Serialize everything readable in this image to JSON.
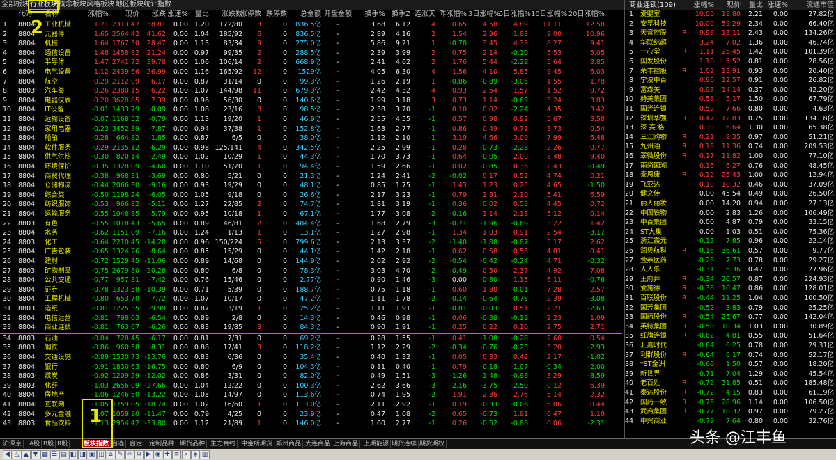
{
  "top_tabs": [
    "全部板块",
    "行业板块",
    "概念板块",
    "风格板块",
    "地区板块",
    "统计指数"
  ],
  "active_tab_index": 1,
  "columns": [
    "代码",
    "名称",
    "涨幅%",
    "现价",
    "涨跌",
    "涨速%",
    "量比",
    "涨跌数",
    "涨停数",
    "跌停数",
    "总金额",
    "开盘金额",
    "换手%",
    "换手Z",
    "连涨天",
    "昨涨幅%",
    "3日涨幅%",
    "5日涨幅%",
    "10日涨幅%",
    "20日涨幅%"
  ],
  "rows": [
    [
      "880446",
      "工业机械",
      "1.71",
      "2313.47",
      "38.81",
      "0.00",
      "1.20",
      "172/80",
      "3",
      "0",
      "836.5亿",
      "-",
      "3.68",
      "6.12",
      "4",
      "0.65",
      "4.58",
      "4.89",
      "11.11",
      "12.58"
    ],
    [
      "880456",
      "元器件",
      "1.65",
      "2564.42",
      "41.62",
      "0.00",
      "1.04",
      "185/92",
      "6",
      "0",
      "836.5亿",
      "-",
      "2.89",
      "4.16",
      "2",
      "1.54",
      "2.96",
      "1.83",
      "9.00",
      "10.96"
    ],
    [
      "880447",
      "机械",
      "1.64",
      "1767.30",
      "28.47",
      "0.00",
      "1.13",
      "83/34",
      "9",
      "0",
      "275.0亿",
      "-",
      "5.86",
      "9.21",
      "1",
      "-0.78",
      "3.45",
      "4.39",
      "8.27",
      "9.41"
    ],
    [
      "880490",
      "通信设备",
      "1.48",
      "1458.82",
      "21.24",
      "0.00",
      "0.97",
      "99/35",
      "2",
      "0",
      "288.5亿",
      "-",
      "2.39",
      "3.99",
      "2",
      "0.75",
      "2.14",
      "-0.10",
      "5.53",
      "5.05"
    ],
    [
      "880491",
      "半导体",
      "1.47",
      "2741.72",
      "39.78",
      "0.00",
      "1.06",
      "106/14",
      "2",
      "0",
      "668.9亿",
      "-",
      "2.41",
      "4.62",
      "2",
      "1.76",
      "5.44",
      "-2.29",
      "5.64",
      "8.85"
    ],
    [
      "880446",
      "电气设备",
      "1.12",
      "2439.66",
      "26.99",
      "0.00",
      "1.16",
      "165/92",
      "12",
      "0",
      "1529亿",
      "-",
      "4.05",
      "6.30",
      "4",
      "1.56",
      "4.10",
      "5.85",
      "9.45",
      "6.03"
    ],
    [
      "880430",
      "航空",
      "0.29",
      "2112.09",
      "6.17",
      "0.00",
      "0.87",
      "31/14",
      "0",
      "0",
      "99.3亿",
      "-",
      "1.26",
      "2.19",
      "1",
      "-0.86",
      "-0.89",
      "-3.06",
      "1.55",
      "1.78"
    ],
    [
      "880390",
      "汽车类",
      "0.26",
      "2380.15",
      "6.22",
      "0.00",
      "1.07",
      "144/98",
      "11",
      "0",
      "679.3亿",
      "-",
      "2.42",
      "4.32",
      "4",
      "0.93",
      "2.54",
      "1.57",
      "1.52",
      "0.72"
    ],
    [
      "880448",
      "电器仪表",
      "0.20",
      "3628.85",
      "7.39",
      "0.00",
      "0.96",
      "56/30",
      "0",
      "0",
      "140.6亿",
      "-",
      "1.99",
      "3.18",
      "3",
      "0.73",
      "1.14",
      "-0.69",
      "3.24",
      "3.83"
    ],
    [
      "880489",
      "IT设备",
      "-0.01",
      "1433.79",
      "-0.09",
      "0.00",
      "1.08",
      "23/16",
      "3",
      "0",
      "98.5亿",
      "-",
      "2.38",
      "3.70",
      "-1",
      "0.10",
      "0.02",
      "-2.24",
      "4.35",
      "3.42"
    ],
    [
      "880432",
      "运输设备",
      "-0.07",
      "1168.52",
      "-0.79",
      "0.00",
      "1.13",
      "19/20",
      "1",
      "0",
      "46.9亿",
      "-",
      "2.55",
      "4.55",
      "-1",
      "0.57",
      "0.98",
      "0.92",
      "5.67",
      "3.58"
    ],
    [
      "880423",
      "家用电器",
      "-0.23",
      "3452.39",
      "-7.87",
      "0.00",
      "0.94",
      "37/38",
      "1",
      "0",
      "152.8亿",
      "-",
      "1.63",
      "2.77",
      "-1",
      "0.86",
      "0.49",
      "0.71",
      "3.73",
      "0.54"
    ],
    [
      "880431",
      "船舶",
      "-0.28",
      "664.82",
      "-1.85",
      "0.00",
      "0.87",
      "6/5",
      "0",
      "0",
      "38.0亿",
      "-",
      "1.12",
      "2.10",
      "-1",
      "3.19",
      "4.66",
      "3.09",
      "7.99",
      "6.48"
    ],
    [
      "880493",
      "软件服务",
      "-0.29",
      "2135.12",
      "-6.29",
      "0.00",
      "0.98",
      "125/141",
      "4",
      "0",
      "342.5亿",
      "-",
      "2.25",
      "2.99",
      "-1",
      "0.28",
      "-0.73",
      "-2.28",
      "2.26",
      "0.77"
    ],
    [
      "880455",
      "供气供热",
      "-0.30",
      "820.14",
      "-2.49",
      "0.00",
      "1.02",
      "10/29",
      "1",
      "0",
      "44.3亿",
      "-",
      "1.70",
      "3.73",
      "-1",
      "0.64",
      "-0.05",
      "2.00",
      "8.48",
      "9.40"
    ],
    [
      "880456",
      "环境保护",
      "-0.35",
      "1328.09",
      "-4.60",
      "0.00",
      "1.10",
      "51/70",
      "1",
      "0",
      "94.4亿",
      "-",
      "1.59",
      "2.66",
      "-1",
      "0.02",
      "-0.85",
      "0.36",
      "2.43",
      "-0.49"
    ],
    [
      "880414",
      "商贸代理",
      "-0.38",
      "968.31",
      "-3.69",
      "0.00",
      "0.80",
      "5/21",
      "0",
      "0",
      "21.3亿",
      "-",
      "1.24",
      "2.41",
      "-2",
      "-0.02",
      "0.17",
      "0.52",
      "4.74",
      "0.21"
    ],
    [
      "880494",
      "仓储物流",
      "-0.44",
      "2066.30",
      "-9.16",
      "0.00",
      "0.93",
      "19/29",
      "0",
      "0",
      "48.1亿",
      "-",
      "0.85",
      "1.75",
      "-1",
      "1.43",
      "1.23",
      "0.25",
      "4.65",
      "-1.50"
    ],
    [
      "880497",
      "综合类",
      "-0.50",
      "1198.24",
      "-6.05",
      "0.00",
      "1.05",
      "9/18",
      "0",
      "0",
      "26.6亿",
      "-",
      "2.17",
      "3.23",
      "-1",
      "0.79",
      "1.81",
      "2.10",
      "5.41",
      "6.59"
    ],
    [
      "880497",
      "纺织服饰",
      "-0.53",
      "966.82",
      "-5.11",
      "0.00",
      "1.27",
      "22/85",
      "2",
      "0",
      "74.7亿",
      "-",
      "1.81",
      "3.19",
      "-1",
      "0.36",
      "0.02",
      "0.53",
      "4.45",
      "0.72"
    ],
    [
      "880453",
      "运输服务",
      "-0.55",
      "1048.85",
      "-5.79",
      "0.00",
      "0.95",
      "10/18",
      "1",
      "0",
      "67.1亿",
      "-",
      "1.77",
      "3.08",
      "-2",
      "-0.16",
      "1.14",
      "2.18",
      "5.12",
      "0.14"
    ],
    [
      "880324",
      "有色",
      "-0.55",
      "1018.43",
      "-5.65",
      "0.00",
      "0.89",
      "46/81",
      "2",
      "0",
      "484.4亿",
      "-",
      "1.68",
      "2.79",
      "-3",
      "-0.71",
      "-1.96",
      "-0.69",
      "3.22",
      "1.42"
    ],
    [
      "880475",
      "水务",
      "-0.62",
      "1151.09",
      "-7.16",
      "0.00",
      "1.24",
      "1/13",
      "1",
      "0",
      "13.1亿",
      "-",
      "1.27",
      "2.98",
      "-1",
      "1.34",
      "1.03",
      "0.91",
      "2.54",
      "-3.17"
    ],
    [
      "880335",
      "化工",
      "-0.64",
      "2210.45",
      "-14.28",
      "0.00",
      "0.96",
      "150/224",
      "5",
      "0",
      "799.6亿",
      "-",
      "2.13",
      "3.37",
      "-2",
      "-1.40",
      "-1.88",
      "-0.87",
      "5.17",
      "2.62"
    ],
    [
      "880421",
      "广告包装",
      "-0.65",
      "1324.26",
      "-8.64",
      "0.00",
      "0.85",
      "15/29",
      "0",
      "0",
      "44.1亿",
      "-",
      "1.42",
      "2.18",
      "-1",
      "0.62",
      "0.58",
      "0.53",
      "4.81",
      "0.41"
    ],
    [
      "880424",
      "建材",
      "-0.72",
      "1529.45",
      "-11.06",
      "0.00",
      "0.89",
      "14/68",
      "0",
      "0",
      "144.9亿",
      "-",
      "2.02",
      "2.92",
      "-2",
      "-0.54",
      "-0.42",
      "-0.24",
      "4.71",
      "-0.32"
    ],
    [
      "880351",
      "矿物制品",
      "-0.75",
      "2679.80",
      "-20.28",
      "0.00",
      "0.80",
      "6/8",
      "0",
      "0",
      "78.3亿",
      "-",
      "3.03",
      "4.70",
      "-2",
      "-0.49",
      "0.50",
      "2.37",
      "4.92",
      "7.08"
    ],
    [
      "880455",
      "公共交通",
      "-0.77",
      "957.81",
      "-7.42",
      "0.00",
      "0.76",
      "15/46",
      "0",
      "0",
      "2.77亿",
      "-",
      "0.90",
      "1.46",
      "-3",
      "0.00",
      "-0.80",
      "1.15",
      "6.11",
      "-0.76"
    ],
    [
      "880472",
      "证券",
      "-0.78",
      "1323.58",
      "-10.39",
      "0.00",
      "0.71",
      "5/39",
      "0",
      "0",
      "188.7亿",
      "-",
      "0.75",
      "1.18",
      "-1",
      "0.60",
      "1.80",
      "-0.01",
      "7.28",
      "2.57"
    ],
    [
      "880447",
      "工程机械",
      "-0.80",
      "653.70",
      "-7.72",
      "0.00",
      "1.07",
      "10/17",
      "0",
      "0",
      "47.2亿",
      "-",
      "1.11",
      "1.78",
      "-2",
      "-0.14",
      "-0.64",
      "-0.78",
      "2.39",
      "-3.08"
    ],
    [
      "880350",
      "造纸",
      "-0.81",
      "1225.35",
      "-9.99",
      "0.00",
      "0.87",
      "3/19",
      "1",
      "0",
      "25.2亿",
      "-",
      "1.11",
      "1.91",
      "-1",
      "-0.81",
      "-0.03",
      "0.51",
      "2.21",
      "-2.63"
    ],
    [
      "880452",
      "电信运营",
      "-0.81",
      "798.03",
      "-6.54",
      "0.00",
      "0.89",
      "2/8",
      "0",
      "0",
      "14.3亿",
      "-",
      "0.46",
      "0.98",
      "-1",
      "0.06",
      "-0.38",
      "-0.19",
      "2.23",
      "1.09"
    ],
    [
      "880406",
      "商业连锁",
      "-0.81",
      "763.67",
      "-6.26",
      "0.00",
      "0.83",
      "19/85",
      "3",
      "0",
      "84.3亿",
      "-",
      "0.90",
      "1.91",
      "-1",
      "0.25",
      "0.22",
      "0.10",
      "2.75",
      "2.71"
    ],
    [
      "880310",
      "石油",
      "-0.84",
      "728.45",
      "-6.17",
      "0.00",
      "0.81",
      "7/31",
      "0",
      "0",
      "69.2亿",
      "-",
      "0.28",
      "1.55",
      "-1",
      "0.41",
      "-1.08",
      "-0.28",
      "2.68",
      "0.54"
    ],
    [
      "880318",
      "钢铁",
      "-0.86",
      "960.58",
      "-8.31",
      "0.00",
      "0.88",
      "17/41",
      "3",
      "0",
      "118.2亿",
      "-",
      "1.12",
      "2.29",
      "-2",
      "-0.34",
      "-0.76",
      "-0.23",
      "3.20",
      "-2.93"
    ],
    [
      "880465",
      "交通设施",
      "-0.89",
      "1530.73",
      "-13.76",
      "0.00",
      "0.83",
      "6/36",
      "0",
      "0",
      "35.4亿",
      "-",
      "0.40",
      "1.32",
      "-1",
      "0.05",
      "0.33",
      "0.42",
      "2.17",
      "-1.02"
    ],
    [
      "880471",
      "银行",
      "-0.91",
      "1830.63",
      "-16.75",
      "0.00",
      "0.80",
      "6/9",
      "0",
      "0",
      "104.3亿",
      "-",
      "0.11",
      "0.40",
      "-1",
      "0.79",
      "-0.18",
      "-1.07",
      "-0.34",
      "-2.00"
    ],
    [
      "880301",
      "煤炭",
      "-0.92",
      "1209.29",
      "-12.02",
      "0.00",
      "0.86",
      "3/31",
      "0",
      "0",
      "82.0亿",
      "-",
      "0.49",
      "1.51",
      "-3",
      "-1.26",
      "-1.48",
      "-0.98",
      "3.29",
      "-8.59"
    ],
    [
      "880330",
      "化纤",
      "-1.03",
      "2656.09",
      "-27.66",
      "0.00",
      "1.04",
      "12/22",
      "0",
      "0",
      "100.3亿",
      "-",
      "2.62",
      "3.66",
      "-3",
      "-2.16",
      "-3.75",
      "-2.50",
      "0.12",
      "6.39"
    ],
    [
      "880482",
      "房地产",
      "-1.06",
      "1246.50",
      "-13.22",
      "0.00",
      "1.03",
      "14/97",
      "0",
      "0",
      "113.6亿",
      "-",
      "0.74",
      "1.95",
      "-2",
      "1.91",
      "2.36",
      "2.76",
      "5.14",
      "2.32"
    ],
    [
      "880494",
      "互联网",
      "-1.05",
      "1759.05",
      "-18.74",
      "0.00",
      "1.02",
      "16/60",
      "1",
      "0",
      "113.0亿",
      "-",
      "2.11",
      "2.92",
      "-1",
      "0.19",
      "-0.33",
      "-0.06",
      "5.86",
      "0.44"
    ],
    [
      "880474",
      "多元金融",
      "-1.07",
      "1059.90",
      "-11.47",
      "0.00",
      "0.79",
      "4/25",
      "0",
      "0",
      "23.9亿",
      "-",
      "0.47",
      "1.08",
      "-2",
      "0.65",
      "-0.73",
      "1.91",
      "6.47",
      "1.10"
    ],
    [
      "880372",
      "食品饮料",
      "-1.13",
      "2954.42",
      "-33.80",
      "0.00",
      "1.12",
      "21/89",
      "1",
      "0",
      "146.0亿",
      "-",
      "1.60",
      "2.77",
      "-1",
      "0.26",
      "-0.52",
      "-0.86",
      "0.06",
      "-2.31"
    ]
  ],
  "separator_after_row": 33,
  "right_panel": {
    "title": "商业连锁(109)",
    "columns": [
      "",
      "涨幅%",
      "现价",
      "量比",
      "涨速%",
      "流通市值"
    ],
    "rows": [
      [
        "1",
        "爱婴室",
        "",
        "10.00",
        "19.80",
        "2.21",
        "0.00",
        "27.82亿"
      ],
      [
        "2",
        "安孚科技",
        "",
        "10.00",
        "59.29",
        "2.34",
        "0.00",
        "66.40亿"
      ],
      [
        "3",
        "天音控股",
        "R",
        "9.98",
        "13.11",
        "2.43",
        "0.00",
        "134.26亿"
      ],
      [
        "4",
        "华联综超",
        "",
        "3.24",
        "7.02",
        "1.36",
        "0.00",
        "46.74亿"
      ],
      [
        "5",
        "一心堂",
        "R",
        "1.11",
        "25.45",
        "1.42",
        "0.00",
        "101.39亿"
      ],
      [
        "6",
        "国发股份",
        "",
        "1.10",
        "5.52",
        "0.81",
        "0.00",
        "28.56亿"
      ],
      [
        "7",
        "荣丰控股",
        "R",
        "1.02",
        "13.91",
        "0.93",
        "0.00",
        "20.40亿"
      ],
      [
        "8",
        "宁波中百",
        "",
        "0.96",
        "12.57",
        "0.91",
        "0.00",
        "26.82亿"
      ],
      [
        "9",
        "富森美",
        "",
        "0.93",
        "14.14",
        "0.37",
        "0.00",
        "42.20亿"
      ],
      [
        "10",
        "赫美集团",
        "",
        "0.58",
        "5.17",
        "1.50",
        "0.00",
        "67.79亿"
      ],
      [
        "11",
        "国光连锁",
        "",
        "0.52",
        "7.66",
        "0.80",
        "0.00",
        "4.63亿"
      ],
      [
        "12",
        "深圳华强",
        "R",
        "0.47",
        "12.83",
        "0.75",
        "0.00",
        "134.18亿"
      ],
      [
        "13",
        "深 赛 格",
        "",
        "0.30",
        "6.64",
        "1.30",
        "0.00",
        "65.38亿"
      ],
      [
        "14",
        "三江购物",
        "R",
        "0.21",
        "9.35",
        "0.97",
        "0.00",
        "51.21亿"
      ],
      [
        "15",
        "九州通",
        "R",
        "0.18",
        "11.36",
        "0.74",
        "0.00",
        "209.53亿"
      ],
      [
        "16",
        "翠微股份",
        "R",
        "0.17",
        "11.82",
        "1.00",
        "0.00",
        "77.10亿"
      ],
      [
        "17",
        "雨尚国潮",
        "",
        "0.16",
        "6.27",
        "0.76",
        "0.00",
        "48.45亿"
      ],
      [
        "18",
        "泰恩康",
        "R",
        "0.12",
        "25.43",
        "1.00",
        "0.00",
        "12.94亿"
      ],
      [
        "19",
        "飞亚达",
        "",
        "0.10",
        "10.32",
        "0.46",
        "0.00",
        "37.09亿"
      ],
      [
        "20",
        "健之佳",
        "",
        "0.00",
        "45.54",
        "0.49",
        "0.00",
        "26.50亿"
      ],
      [
        "21",
        "丽人丽妆",
        "",
        "0.00",
        "14.20",
        "0.94",
        "0.00",
        "27.13亿"
      ],
      [
        "22",
        "中国铁物",
        "",
        "0.00",
        "2.83",
        "1.26",
        "0.00",
        "106.49亿"
      ],
      [
        "23",
        "中百集团",
        "",
        "0.00",
        "4.87",
        "0.79",
        "0.00",
        "33.15亿"
      ],
      [
        "24",
        "ST大集",
        "",
        "0.00",
        "1.03",
        "0.51",
        "0.00",
        "75.36亿"
      ],
      [
        "25",
        "浙江震元",
        "",
        "-0.13",
        "7.85",
        "0.96",
        "0.00",
        "22.14亿"
      ],
      [
        "26",
        "润贝航科",
        "R",
        "-0.16",
        "36.61",
        "0.57",
        "0.00",
        "9.77亿"
      ],
      [
        "27",
        "萱燕医药",
        "",
        "-0.26",
        "7.73",
        "0.78",
        "0.00",
        "29.27亿"
      ],
      [
        "28",
        "人人乐",
        "",
        "-0.31",
        "6.36",
        "0.47",
        "0.00",
        "27.96亿"
      ],
      [
        "29",
        "王府井",
        "R",
        "-0.34",
        "20.57",
        "0.87",
        "0.00",
        "224.93亿"
      ],
      [
        "30",
        "爱施德",
        "R",
        "-0.38",
        "10.47",
        "0.86",
        "0.00",
        "128.01亿"
      ],
      [
        "31",
        "百联股份",
        "R",
        "-0.44",
        "11.25",
        "1.04",
        "0.00",
        "100.50亿"
      ],
      [
        "32",
        "国芳集团",
        "",
        "-0.52",
        "3.83",
        "0.79",
        "0.00",
        "25.25亿"
      ],
      [
        "33",
        "国药股份",
        "R",
        "-0.54",
        "25.67",
        "0.77",
        "0.00",
        "142.04亿"
      ],
      [
        "34",
        "英特集团",
        "R",
        "-0.58",
        "10.34",
        "1.03",
        "0.00",
        "30.89亿"
      ],
      [
        "35",
        "红旗连锁",
        "R",
        "-0.62",
        "4.81",
        "0.55",
        "0.00",
        "51.64亿"
      ],
      [
        "36",
        "汇嘉时代",
        "",
        "-0.64",
        "6.25",
        "0.78",
        "0.00",
        "29.31亿"
      ],
      [
        "37",
        "利群股份",
        "R",
        "-0.64",
        "6.17",
        "0.74",
        "0.00",
        "52.17亿"
      ],
      [
        "38",
        "*ST金洲",
        "",
        "-0.66",
        "1.50",
        "0.57",
        "0.00",
        "18.20亿"
      ],
      [
        "39",
        "新世界",
        "",
        "-0.71",
        "7.04",
        "1.29",
        "0.00",
        "45.54亿"
      ],
      [
        "40",
        "老百姓",
        "R",
        "-0.72",
        "31.85",
        "0.51",
        "0.00",
        "185.48亿"
      ],
      [
        "41",
        "泰达股份",
        "R",
        "-0.72",
        "4.15",
        "0.83",
        "0.00",
        "61.19亿"
      ],
      [
        "42",
        "国药一致",
        "R",
        "-0.75",
        "28.96",
        "1.14",
        "0.00",
        "106.50亿"
      ],
      [
        "43",
        "武商集团",
        "R",
        "-0.77",
        "10.32",
        "0.97",
        "0.00",
        "79.27亿"
      ],
      [
        "44",
        "中兴商业",
        "",
        "-0.79",
        "7.64",
        "0.80",
        "0.00",
        "32.76亿"
      ]
    ]
  },
  "bottom_tabs": [
    "沪深京",
    "A股",
    "B股",
    "R股",
    "板块指数",
    "自选",
    "自定",
    "定制品种",
    "期货品种",
    "主力合约",
    "中金所期货",
    "郑州商品",
    "大连商品",
    "上海商品",
    "上期能源",
    "期货连续",
    "期货期权"
  ],
  "bottom_active_index": 4,
  "annotations": [
    "1",
    "2"
  ],
  "watermark": "头条 @江丰鱼",
  "colors": {
    "up": "#ff3b3b",
    "down": "#00e000",
    "name": "#e6e600",
    "accent": "#b00000",
    "annotation": "#e6e600"
  }
}
